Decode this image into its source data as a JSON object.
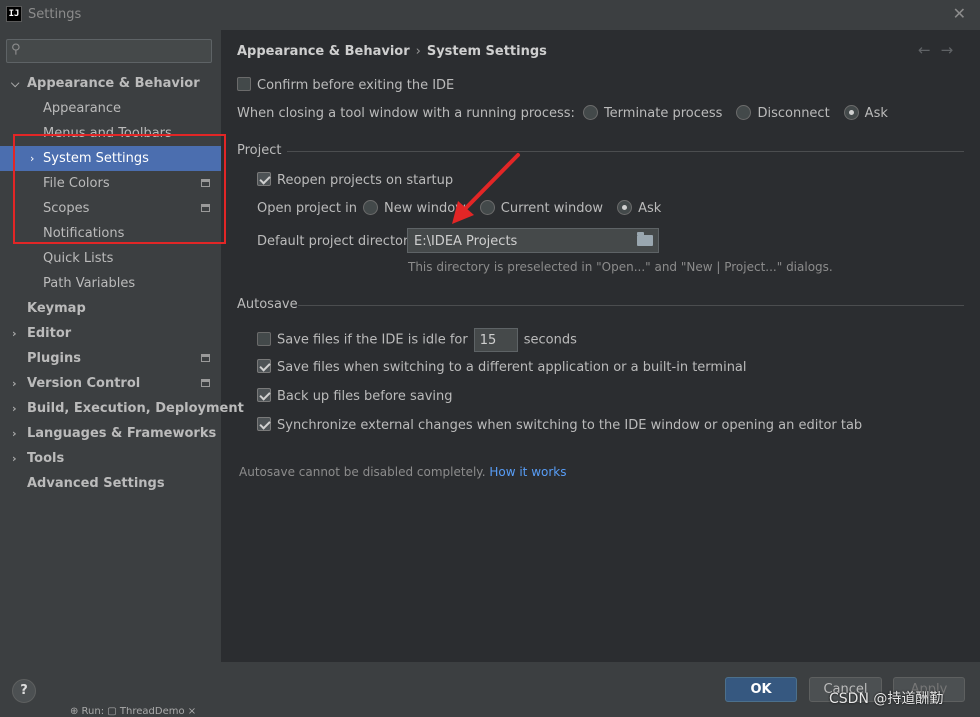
{
  "window": {
    "title": "Settings",
    "app_icon_text": "IJ",
    "close_glyph": "✕"
  },
  "search": {
    "icon": "⚲",
    "placeholder": "",
    "value": ""
  },
  "sidebar": {
    "items": [
      {
        "label": "Appearance & Behavior",
        "arrow": "⌵"
      },
      {
        "label": "Appearance"
      },
      {
        "label": "Menus and Toolbars"
      },
      {
        "label": "System Settings",
        "arrow": "›"
      },
      {
        "label": "File Colors"
      },
      {
        "label": "Scopes"
      },
      {
        "label": "Notifications"
      },
      {
        "label": "Quick Lists"
      },
      {
        "label": "Path Variables"
      },
      {
        "label": "Keymap"
      },
      {
        "label": "Editor",
        "arrow": "›"
      },
      {
        "label": "Plugins"
      },
      {
        "label": "Version Control",
        "arrow": "›"
      },
      {
        "label": "Build, Execution, Deployment",
        "arrow": "›"
      },
      {
        "label": "Languages & Frameworks",
        "arrow": "›"
      },
      {
        "label": "Tools",
        "arrow": "›"
      },
      {
        "label": "Advanced Settings"
      }
    ]
  },
  "breadcrumb": {
    "parent": "Appearance & Behavior",
    "separator": "›",
    "current": "System Settings",
    "back": "←",
    "forward": "→"
  },
  "general": {
    "confirm_exit": {
      "label": "Confirm before exiting the IDE",
      "checked": false
    },
    "closing_label": "When closing a tool window with a running process:",
    "closing_options": [
      {
        "label": "Terminate process",
        "selected": false
      },
      {
        "label": "Disconnect",
        "selected": false
      },
      {
        "label": "Ask",
        "selected": true
      }
    ]
  },
  "project": {
    "title": "Project",
    "reopen": {
      "label": "Reopen projects on startup",
      "checked": true
    },
    "open_label": "Open project in",
    "open_options": [
      {
        "label": "New window",
        "selected": false
      },
      {
        "label": "Current window",
        "selected": false
      },
      {
        "label": "Ask",
        "selected": true
      }
    ],
    "dir_label": "Default project directory:",
    "dir_value": "E:\\IDEA Projects",
    "dir_hint": "This directory is preselected in \"Open...\" and \"New | Project...\" dialogs."
  },
  "autosave": {
    "title": "Autosave",
    "idle": {
      "label_before": "Save files if the IDE is idle for",
      "value": "15",
      "label_after": "seconds",
      "checked": false
    },
    "options": [
      {
        "label": "Save files when switching to a different application or a built-in terminal",
        "checked": true
      },
      {
        "label": "Back up files before saving",
        "checked": true
      },
      {
        "label": "Synchronize external changes when switching to the IDE window or opening an editor tab",
        "checked": true
      }
    ],
    "note": "Autosave cannot be disabled completely.",
    "link": "How it works"
  },
  "buttons": {
    "ok": "OK",
    "cancel": "Cancel",
    "apply": "Apply",
    "help": "?"
  },
  "watermark": "CSDN @持道酬勤",
  "bottom_strip": "⊕  Run:   ▢ ThreadDemo  ×",
  "colors": {
    "selection": "#4b6eaf",
    "annotation": "#e22626",
    "link": "#589df6",
    "ok_button": "#365880"
  }
}
